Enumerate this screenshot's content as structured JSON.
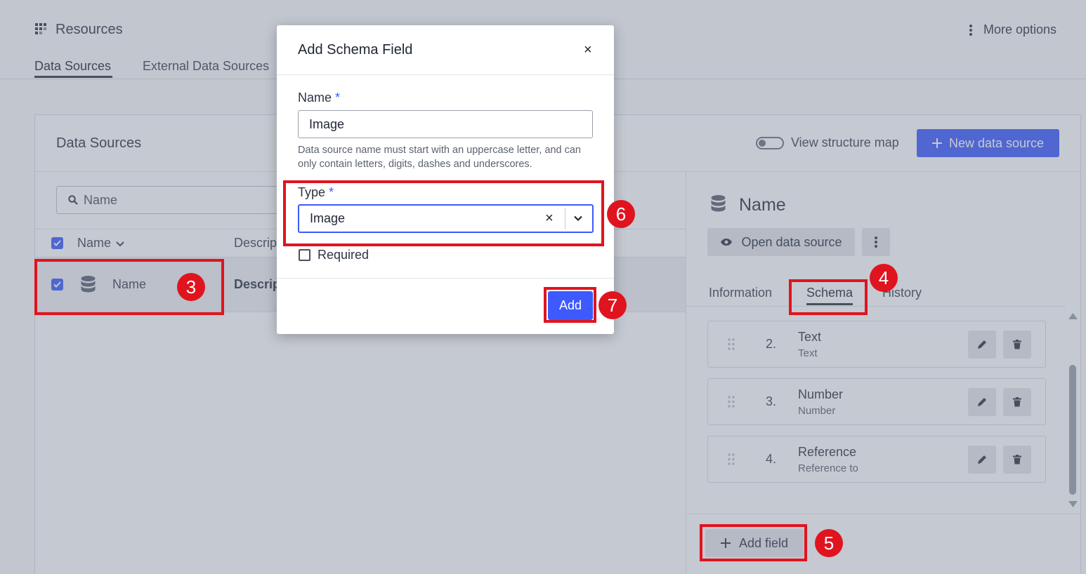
{
  "header": {
    "title": "Resources",
    "more_options": "More options",
    "tabs": [
      {
        "label": "Data Sources"
      },
      {
        "label": "External Data Sources"
      }
    ]
  },
  "card": {
    "title": "Data Sources",
    "view_structure_map": "View structure map",
    "new_data_source": "New data source",
    "search_placeholder": "Name",
    "columns": {
      "name": "Name",
      "description": "Descrip"
    },
    "row": {
      "name": "Name",
      "description": "Descrip"
    }
  },
  "right_panel": {
    "title": "Name",
    "open_data_source": "Open data source",
    "tabs": {
      "information": "Information",
      "schema": "Schema",
      "history": "History"
    },
    "fields": [
      {
        "num": "2.",
        "name": "Text",
        "type": "Text"
      },
      {
        "num": "3.",
        "name": "Number",
        "type": "Number"
      },
      {
        "num": "4.",
        "name": "Reference",
        "type": "Reference to"
      }
    ],
    "add_field": "Add field"
  },
  "modal": {
    "title": "Add Schema Field",
    "close": "×",
    "name_label": "Name",
    "required_mark": "*",
    "name_value": "Image",
    "hint": "Data source name must start with an uppercase letter, and can only contain letters, digits, dashes and underscores.",
    "type_label": "Type",
    "type_value": "Image",
    "clear": "×",
    "required_label": "Required",
    "add_button": "Add"
  },
  "annotations": [
    "3",
    "4",
    "5",
    "6",
    "7"
  ],
  "colors": {
    "accent": "#3d5afe",
    "annotation": "#e0141e"
  }
}
